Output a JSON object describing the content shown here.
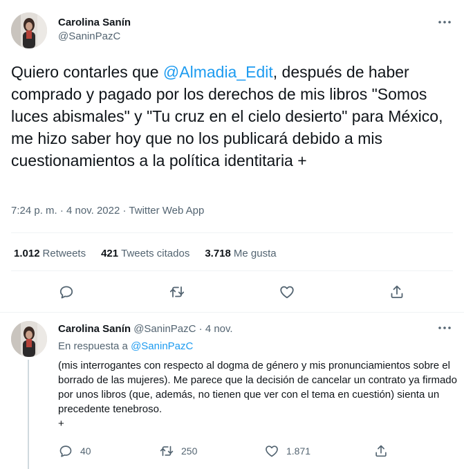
{
  "main_tweet": {
    "author_name": "Carolina Sanín",
    "author_handle": "@SaninPazC",
    "text_before_mention": "Quiero contarles que ",
    "mention": "@Almadia_Edit",
    "text_after_mention": ", después de haber comprado y pagado por los derechos de mis libros \"Somos luces abismales\" y \"Tu cruz en el cielo desierto\" para México, me hizo saber hoy que no los publicará debido a mis cuestionamientos a la política identitaria   +",
    "time": "7:24 p. m.",
    "date": "4 nov. 2022",
    "source": "Twitter Web App",
    "separator": "·",
    "stats": {
      "retweets_count": "1.012",
      "retweets_label": "Retweets",
      "quotes_count": "421",
      "quotes_label": "Tweets citados",
      "likes_count": "3.718",
      "likes_label": "Me gusta"
    },
    "actions": [
      "reply-icon",
      "retweet-icon",
      "like-icon",
      "share-icon"
    ]
  },
  "reply_tweet": {
    "author_name": "Carolina Sanín",
    "author_handle": "@SaninPazC",
    "separator": "·",
    "date": "4 nov.",
    "replying_label": "En respuesta a",
    "replying_to": "@SaninPazC",
    "text": "(mis interrogantes con respecto al dogma de género y mis pronunciamientos sobre el borrado de las mujeres). Me parece que la decisión de cancelar un contrato ya firmado por unos libros (que, además, no tienen que ver con el tema en cuestión) sienta un precedente tenebroso.\n+",
    "replies_count": "40",
    "retweets_count": "250",
    "likes_count": "1.871"
  },
  "colors": {
    "text": "#0f1419",
    "secondary": "#536471",
    "accent": "#1d9bf0",
    "divider": "#eff3f4"
  }
}
